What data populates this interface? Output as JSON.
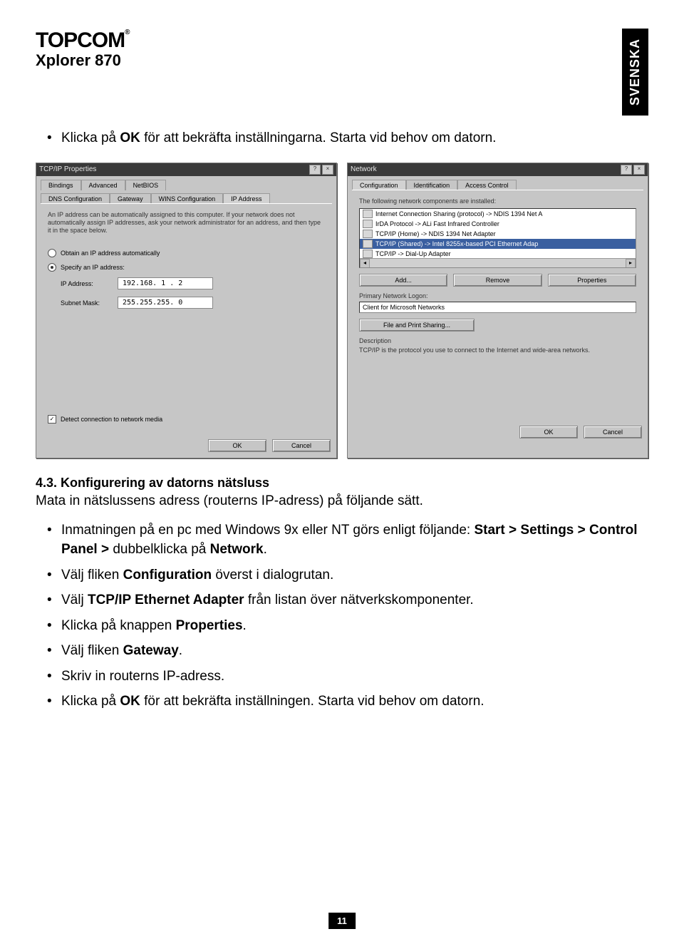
{
  "brand": "TOPCOM",
  "product": "Xplorer 870",
  "lang_tab": "SVENSKA",
  "bullet_top_prefix": "Klicka på ",
  "bullet_top_bold": "OK",
  "bullet_top_suffix": " för att bekräfta inställningarna. Starta vid behov om datorn.",
  "section_heading": "4.3. Konfigurering av datorns nätsluss",
  "section_sub": "Mata in nätslussens adress (routerns IP-adress) på följande sätt.",
  "bullets": {
    "b1_pre": "Inmatningen på en pc med Windows 9x eller NT görs enligt följande: ",
    "b1_s1": "Start > Settings > Control Panel > ",
    "b1_mid": "dubbelklicka på ",
    "b1_s2": "Network",
    "b1_post": ".",
    "b2_pre": "Välj fliken ",
    "b2_bold": "Configuration",
    "b2_post": " överst i dialogrutan.",
    "b3_pre": "Välj ",
    "b3_bold": "TCP/IP Ethernet Adapter",
    "b3_post": " från listan över nätverkskomponenter.",
    "b4_pre": "Klicka på knappen ",
    "b4_bold": "Properties",
    "b4_post": ".",
    "b5_pre": "Välj fliken ",
    "b5_bold": "Gateway",
    "b5_post": ".",
    "b6": "Skriv in routerns IP-adress.",
    "b7_pre": "Klicka på ",
    "b7_bold": "OK",
    "b7_post": " för att bekräfta inställningen. Starta vid behov om datorn."
  },
  "dlg_tcpip": {
    "title": "TCP/IP Properties",
    "tabs_row1": [
      "Bindings",
      "Advanced",
      "NetBIOS"
    ],
    "tabs_row2": [
      "DNS Configuration",
      "Gateway",
      "WINS Configuration",
      "IP Address"
    ],
    "desc": "An IP address can be automatically assigned to this computer. If your network does not automatically assign IP addresses, ask your network administrator for an address, and then type it in the space below.",
    "radio_auto": "Obtain an IP address automatically",
    "radio_spec": "Specify an IP address:",
    "ip_label": "IP Address:",
    "ip_value": "192.168. 1 . 2",
    "mask_label": "Subnet Mask:",
    "mask_value": "255.255.255. 0",
    "chk_detect": "Detect connection to network media",
    "ok": "OK",
    "cancel": "Cancel"
  },
  "dlg_net": {
    "title": "Network",
    "tabs": [
      "Configuration",
      "Identification",
      "Access Control"
    ],
    "list_label": "The following network components are installed:",
    "items": [
      "Internet Connection Sharing (protocol) -> NDIS 1394 Net A",
      "IrDA Protocol -> ALi Fast Infrared Controller",
      "TCP/IP (Home) -> NDIS 1394 Net Adapter",
      "TCP/IP (Shared) -> Intel 8255x-based PCI Ethernet Adap",
      "TCP/IP -> Dial-Up Adapter"
    ],
    "sel_index": 3,
    "add": "Add...",
    "remove": "Remove",
    "properties": "Properties",
    "logon_label": "Primary Network Logon:",
    "logon_value": "Client for Microsoft Networks",
    "fps": "File and Print Sharing...",
    "desc_label": "Description",
    "desc_text": "TCP/IP is the protocol you use to connect to the Internet and wide-area networks.",
    "ok": "OK",
    "cancel": "Cancel"
  },
  "page_number": "11"
}
